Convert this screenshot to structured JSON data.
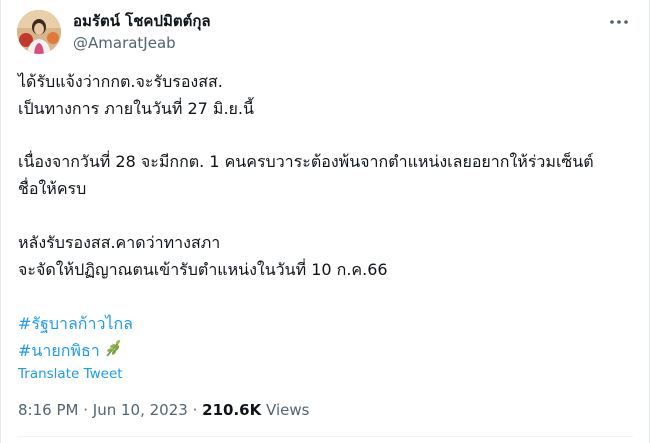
{
  "author": {
    "display_name": "อมรัตน์ โชคปมิตต์กุล",
    "handle": "@AmaratJeab"
  },
  "tweet": {
    "lines": [
      "ได้รับแจ้งว่ากกต.จะรับรองสส.",
      "เป็นทางการ ภายในวันที่ 27 มิ.ย.นี้",
      "เนื่องจากวันที่ 28 จะมีกกต. 1 คนครบวาระต้องพ้นจากตำแหน่งเลยอยากให้ร่วมเซ็นต์",
      "ชื่อให้ครบ",
      "หลังรับรองสส.คาดว่าทางสภา",
      "จะจัดให้ปฏิญาณตนเข้ารับตำแหน่งในวันที่ 10 ก.ค.66"
    ],
    "hashtags": [
      "#รัฐบาลก้าวไกล",
      "#นายกพิธา"
    ],
    "translate_label": "Translate Tweet"
  },
  "meta": {
    "time": "8:16 PM",
    "separator": "·",
    "date": "Jun 10, 2023",
    "views_count": "210.6K",
    "views_label": "Views"
  },
  "icons": {
    "more": "more-horizontal-icon",
    "plant": "seedling-emoji-icon"
  },
  "colors": {
    "accent": "#1d9bf0",
    "secondary_text": "#536471",
    "primary_text": "#0f1419"
  }
}
